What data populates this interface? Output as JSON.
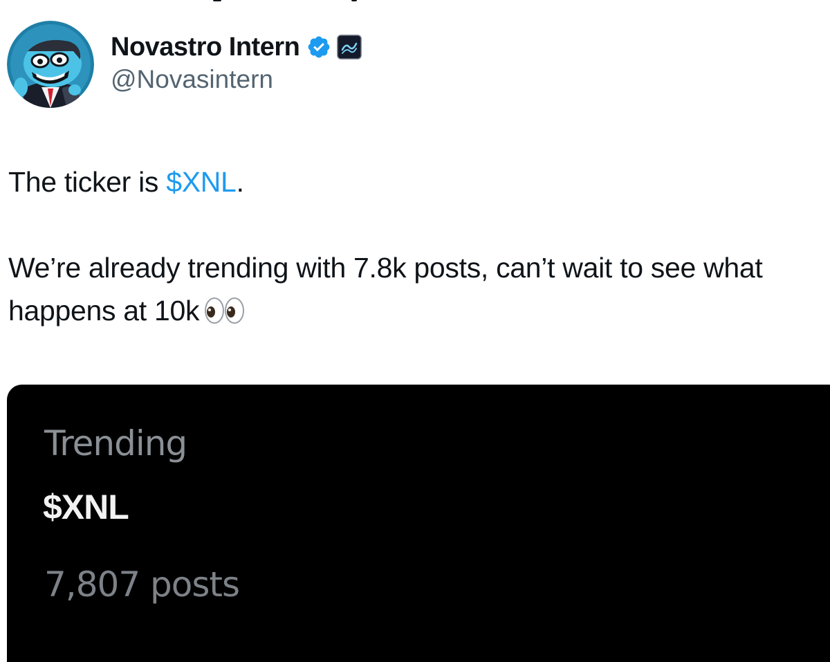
{
  "author": {
    "display_name": "Novastro Intern",
    "handle": "@Novasintern",
    "avatar_icon": "cartoon-intern-avatar",
    "verified_icon": "verified-badge-icon",
    "affiliate_icon": "novastro-logo-icon"
  },
  "tweet": {
    "line1_prefix": "The ticker is ",
    "line1_cashtag": "$XNL",
    "line1_suffix": ".",
    "line2": "We’re already trending with 7.8k posts, can’t wait to see what happens at 10k",
    "emoji": "eyes-emoji"
  },
  "media": {
    "trend_label": "Trending",
    "trend_name": "$XNL",
    "trend_count": "7,807 posts"
  },
  "colors": {
    "link_blue": "#1d9bf0",
    "verified_blue": "#1d9bf0",
    "text_primary": "#0f1419",
    "text_secondary": "#536471",
    "media_bg": "#000000"
  }
}
